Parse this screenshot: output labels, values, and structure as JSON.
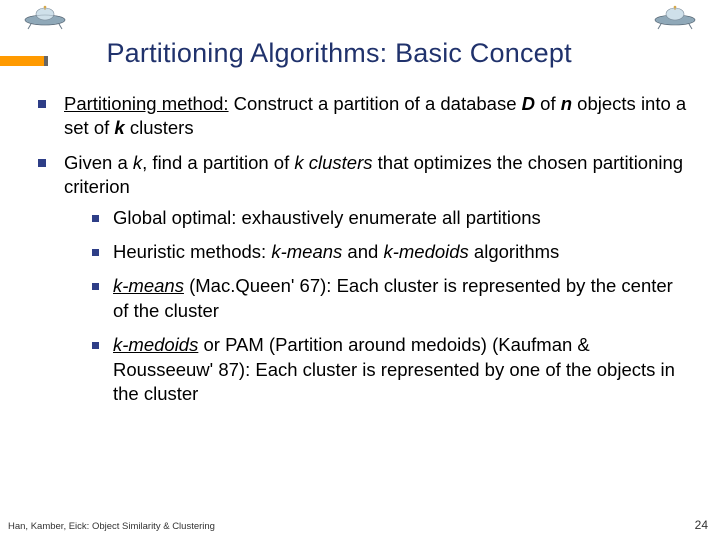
{
  "title": "Partitioning Algorithms: Basic Concept",
  "bullets": {
    "b1_pre": "Partitioning method:",
    "b1_mid1": " Construct a partition of a database ",
    "b1_D": "D",
    "b1_mid2": " of ",
    "b1_n": "n",
    "b1_mid3": " objects into a set of ",
    "b1_k": "k",
    "b1_end": " clusters",
    "b2_pre": "Given a ",
    "b2_k": "k",
    "b2_mid": ", find a partition of ",
    "b2_kc": "k clusters",
    "b2_end": " that optimizes the chosen partitioning criterion",
    "s1": "Global optimal: exhaustively enumerate all partitions",
    "s2_pre": "Heuristic methods: ",
    "s2_km": "k-means",
    "s2_and": " and ",
    "s2_kmed": "k-medoids",
    "s2_end": " algorithms",
    "s3_km": "k-means",
    "s3_rest": " (Mac.Queen' 67): Each cluster is represented by the center of the cluster",
    "s4_kmed": "k-medoids",
    "s4_rest": " or PAM (Partition around medoids) (Kaufman & Rousseeuw' 87): Each cluster is represented by one of the objects in the cluster"
  },
  "footer": {
    "left": "Han, Kamber, Eick: Object Similarity & Clustering",
    "right": "24"
  }
}
